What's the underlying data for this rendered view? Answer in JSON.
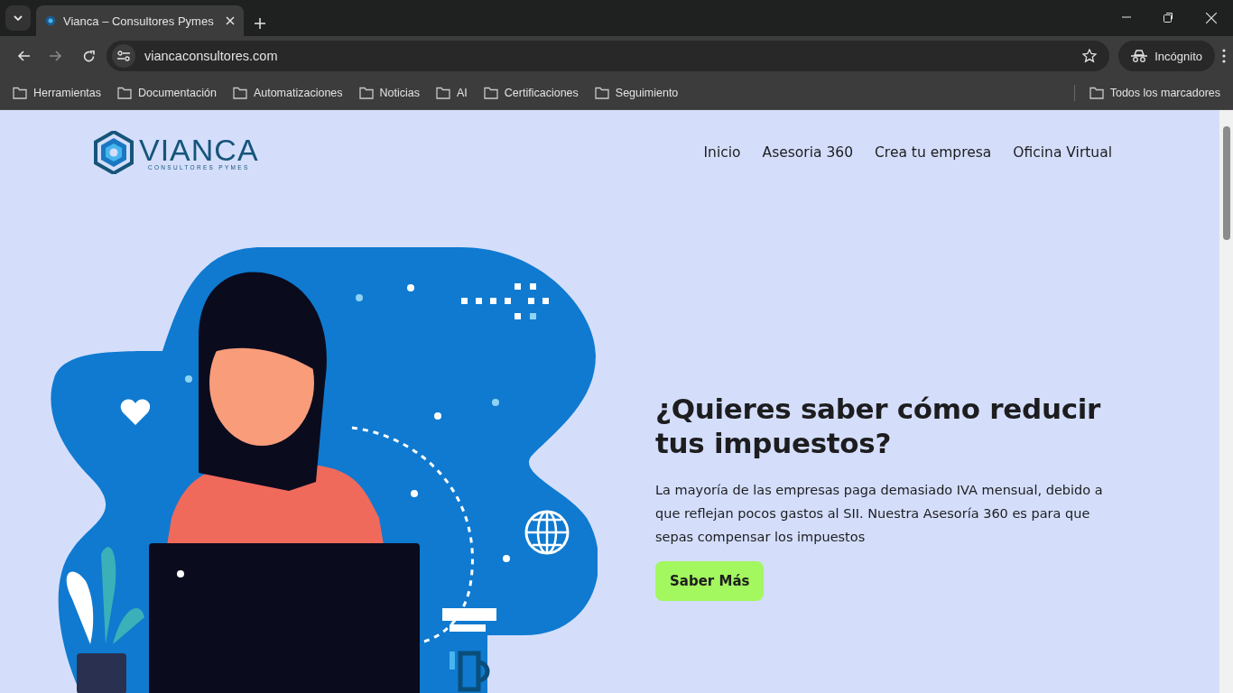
{
  "browser": {
    "tab_title": "Vianca – Consultores Pymes",
    "url": "viancaconsultores.com",
    "profile": "Incógnito",
    "bookmarks": [
      "Herramientas",
      "Documentación",
      "Automatizaciones",
      "Noticias",
      "AI",
      "Certificaciones",
      "Seguimiento"
    ],
    "all_bookmarks": "Todos los marcadores"
  },
  "site": {
    "logo": {
      "name": "VIANCA",
      "tagline": "CONSULTORES PYMES"
    },
    "nav": [
      "Inicio",
      "Asesoria 360",
      "Crea tu empresa",
      "Oficina Virtual"
    ],
    "hero": {
      "heading": "¿Quieres saber cómo reducir tus impuestos?",
      "body": "La mayoría de las empresas paga demasiado IVA mensual, debido a que reflejan pocos gastos al SII. Nuestra Asesoría 360 es para que sepas compensar los impuestos",
      "button": "Saber Más"
    }
  }
}
